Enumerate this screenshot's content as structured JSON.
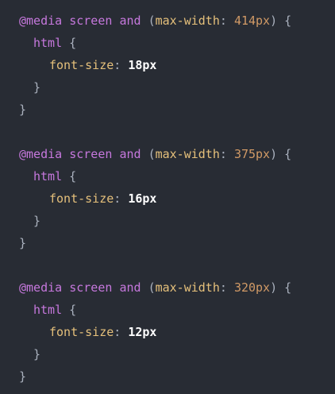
{
  "editor": {
    "background": "#282c34",
    "blocks": [
      {
        "at_keyword": "@media",
        "media_type": "screen",
        "and_keyword": "and",
        "open_paren": "(",
        "feature": "max-width",
        "colon": ":",
        "value": "414px",
        "close_paren_brace": ") {",
        "selector": "html",
        "selector_brace": " {",
        "property": "font-size",
        "property_colon": ":",
        "property_value": "18px",
        "inner_close": "}",
        "outer_close": "}"
      },
      {
        "at_keyword": "@media",
        "media_type": "screen",
        "and_keyword": "and",
        "open_paren": "(",
        "feature": "max-width",
        "colon": ":",
        "value": "375px",
        "close_paren_brace": ") {",
        "selector": "html",
        "selector_brace": " {",
        "property": "font-size",
        "property_colon": ":",
        "property_value": "16px",
        "inner_close": "}",
        "outer_close": "}"
      },
      {
        "at_keyword": "@media",
        "media_type": "screen",
        "and_keyword": "and",
        "open_paren": "(",
        "feature": "max-width",
        "colon": ":",
        "value": "320px",
        "close_paren_brace": ") {",
        "selector": "html",
        "selector_brace": " {",
        "property": "font-size",
        "property_colon": ":",
        "property_value": "12px",
        "inner_close": "}",
        "outer_close": "}"
      }
    ]
  }
}
